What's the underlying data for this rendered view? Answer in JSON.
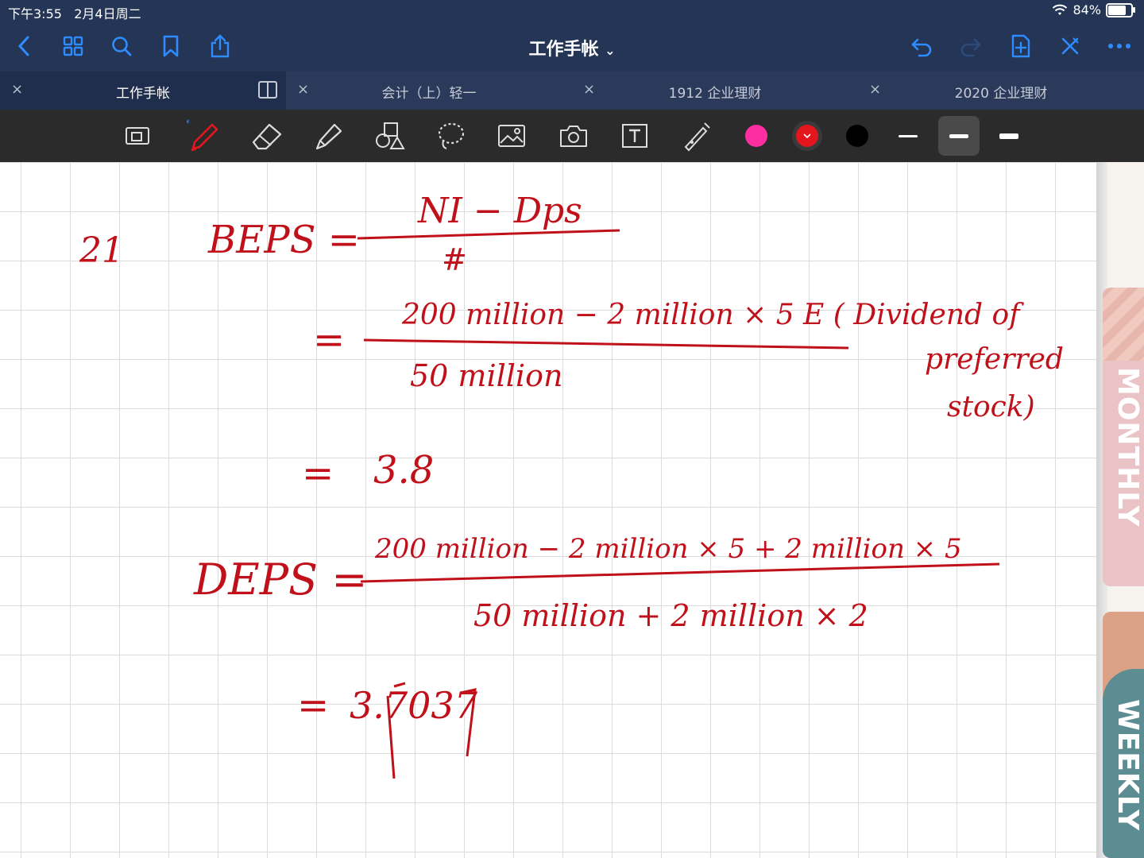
{
  "status": {
    "time": "下午3:55",
    "date": "2月4日周二",
    "battery": "84%",
    "battery_level": 0.84
  },
  "nav": {
    "title": "工作手帐",
    "chevron": "⌄"
  },
  "tabs": [
    {
      "label": "工作手帐",
      "close": "×"
    },
    {
      "label": "会计（上）轻一",
      "close": "×"
    },
    {
      "label": "1912 企业理财",
      "close": "×"
    },
    {
      "label": "2020 企业理财",
      "close": "×"
    }
  ],
  "colors": {
    "pink": "#ff2ea0",
    "red": "#e3161d",
    "black": "#000000",
    "ink": "#c0101a"
  },
  "side_tabs": {
    "monthly": "MONTHLY",
    "weekly": "WEEKLY"
  },
  "notes": {
    "q": "21",
    "beps_lhs": "BEPS =",
    "beps_num": "NI − Dps",
    "beps_den": "#",
    "eq1": "=",
    "l1_num": "200 million  −  2 million × 5 E ( Dividend of",
    "l1_preferred": "preferred",
    "l1_stock": "stock)",
    "l1_den": "50 million",
    "eq2": "=",
    "r1": "3.8",
    "deps_lhs": "DEPS =",
    "deps_num": "200 million − 2 million × 5 + 2 million × 5",
    "deps_den": "50 million + 2 million × 2",
    "eq3": "=",
    "r2": "3.7037"
  }
}
